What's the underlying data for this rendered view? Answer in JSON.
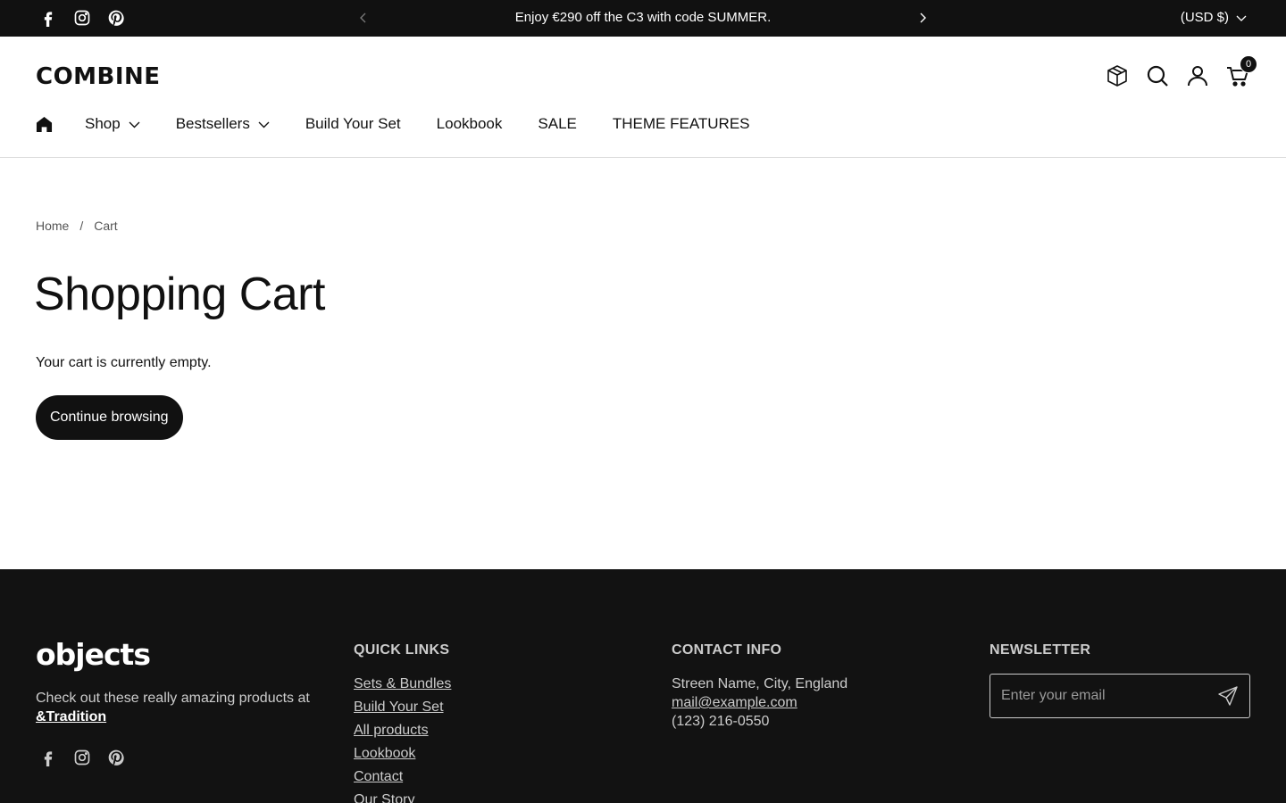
{
  "announcement": {
    "message": "Enjoy €290 off the C3 with code SUMMER.",
    "currency": "(USD $)"
  },
  "header": {
    "logo": "COMBINE",
    "cart_count": "0"
  },
  "nav": {
    "items": [
      {
        "label": "Shop"
      },
      {
        "label": "Bestsellers"
      },
      {
        "label": "Build Your Set"
      },
      {
        "label": "Lookbook"
      },
      {
        "label": "SALE"
      },
      {
        "label": "THEME FEATURES"
      }
    ]
  },
  "breadcrumb": {
    "home": "Home",
    "separator": "/",
    "current": "Cart"
  },
  "main": {
    "title": "Shopping Cart",
    "empty_message": "Your cart is currently empty.",
    "continue_label": "Continue browsing"
  },
  "footer": {
    "logo": "objects",
    "description_prefix": "Check out these really amazing products at ",
    "description_link": "&Tradition",
    "quick_links_title": "QUICK LINKS",
    "quick_links": [
      "Sets & Bundles",
      "Build Your Set",
      "All products",
      "Lookbook",
      "Contact",
      "Our Story"
    ],
    "contact_title": "CONTACT INFO",
    "contact_address": "Streen Name, City, England",
    "contact_email": "mail@example.com",
    "contact_phone": "(123) 216-0550",
    "newsletter_title": "NEWSLETTER",
    "newsletter_placeholder": "Enter your email"
  },
  "icons": {
    "social": [
      "facebook-icon",
      "instagram-icon",
      "pinterest-icon"
    ],
    "header": [
      "box-icon",
      "search-icon",
      "account-icon",
      "cart-icon"
    ],
    "nav_home": "home-icon",
    "newsletter_submit": "send-icon"
  },
  "colors": {
    "announcement_bg": "#111111",
    "footer_bg": "#121212",
    "button_bg": "#111111",
    "text": "#111111"
  }
}
